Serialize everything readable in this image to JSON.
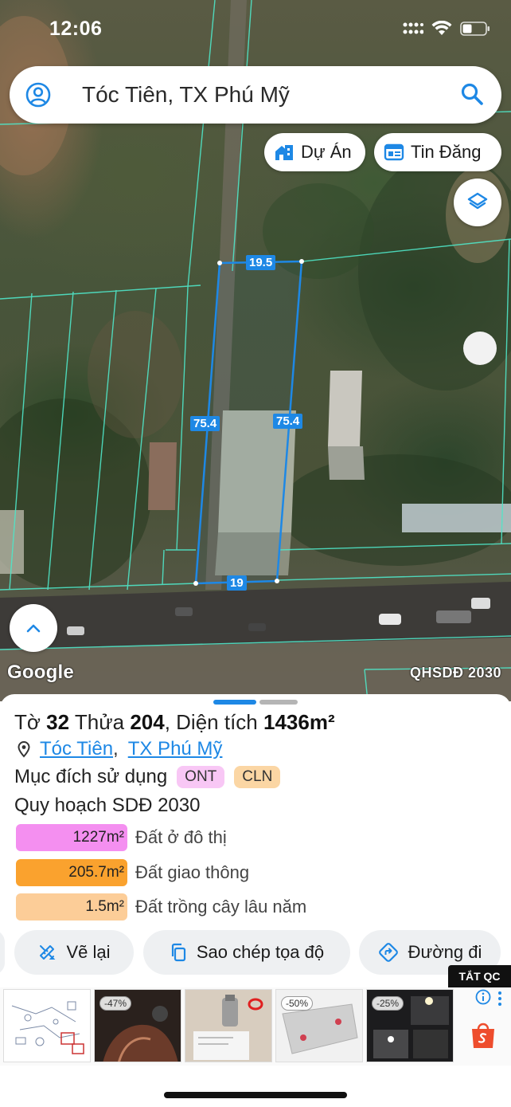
{
  "status_bar": {
    "time": "12:06"
  },
  "search": {
    "query": "Tóc Tiên, TX Phú Mỹ"
  },
  "map_buttons": {
    "projects_label": "Dự Án",
    "listings_label": "Tin Đăng"
  },
  "map": {
    "attribution": "Google",
    "overlay_label": "QHSDĐ 2030",
    "dimensions": {
      "top": "19.5",
      "left": "75.4",
      "right": "75.4",
      "bottom": "19"
    },
    "parcel_color": "#1e88e5",
    "boundary_color": "#4fe6c8"
  },
  "parcel": {
    "sheet_prefix": "Tờ",
    "sheet_no": "32",
    "lot_prefix": "Thửa",
    "lot_no": "204",
    "area_prefix": ", Diện tích",
    "area": "1436m²",
    "ward": "Tóc Tiên",
    "town": "TX Phú Mỹ",
    "purpose_label": "Mục đích sử dụng",
    "purpose_tags": [
      "ONT",
      "CLN"
    ],
    "plan_title": "Quy hoạch SDĐ 2030",
    "plan": [
      {
        "area": "1227m²",
        "label": "Đất ở đô thị",
        "color": "#f48ff0"
      },
      {
        "area": "205.7m²",
        "label": "Đất giao thông",
        "color": "#faa22e"
      },
      {
        "area": "1.5m²",
        "label": "Đất trồng cây lâu năm",
        "color": "#fccd98"
      }
    ]
  },
  "actions": {
    "redraw": "Vẽ lại",
    "copy_coords": "Sao chép tọa độ",
    "directions": "Đường đi"
  },
  "ad": {
    "close_label": "TẮT QC",
    "badges": [
      "-47%",
      "-50%",
      "-25%"
    ]
  }
}
